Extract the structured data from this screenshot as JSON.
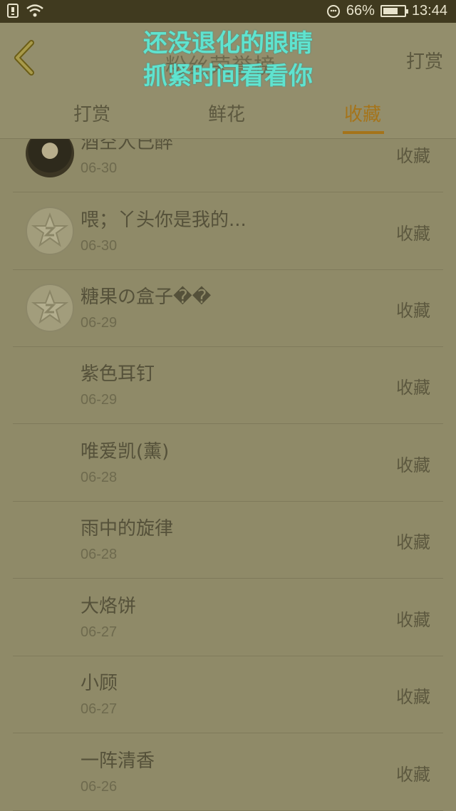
{
  "status_bar": {
    "battery_percent": "66%",
    "time": "13:44"
  },
  "header": {
    "title": "粉丝荣誉榜",
    "right_action": "打赏",
    "overlay_line1": "还没退化的眼睛",
    "overlay_line2": "抓紧时间看看你"
  },
  "tabs": [
    {
      "label": "打赏",
      "active": false
    },
    {
      "label": "鲜花",
      "active": false
    },
    {
      "label": "收藏",
      "active": true
    }
  ],
  "list": [
    {
      "name": "酒空人已醉",
      "date": "06-30",
      "action": "收藏",
      "avatar": "photo"
    },
    {
      "name": "喂；丫头你是我的...",
      "date": "06-30",
      "action": "收藏",
      "avatar": "default"
    },
    {
      "name": "糖果の盒子��",
      "date": "06-29",
      "action": "收藏",
      "avatar": "default"
    },
    {
      "name": "紫色耳钉",
      "date": "06-29",
      "action": "收藏",
      "avatar": "none"
    },
    {
      "name": "唯爱凯(薰)",
      "date": "06-28",
      "action": "收藏",
      "avatar": "none"
    },
    {
      "name": "雨中的旋律",
      "date": "06-28",
      "action": "收藏",
      "avatar": "none"
    },
    {
      "name": "大烙饼",
      "date": "06-27",
      "action": "收藏",
      "avatar": "none"
    },
    {
      "name": "小顾",
      "date": "06-27",
      "action": "收藏",
      "avatar": "none"
    },
    {
      "name": "一阵清香",
      "date": "06-26",
      "action": "收藏",
      "avatar": "none"
    }
  ]
}
